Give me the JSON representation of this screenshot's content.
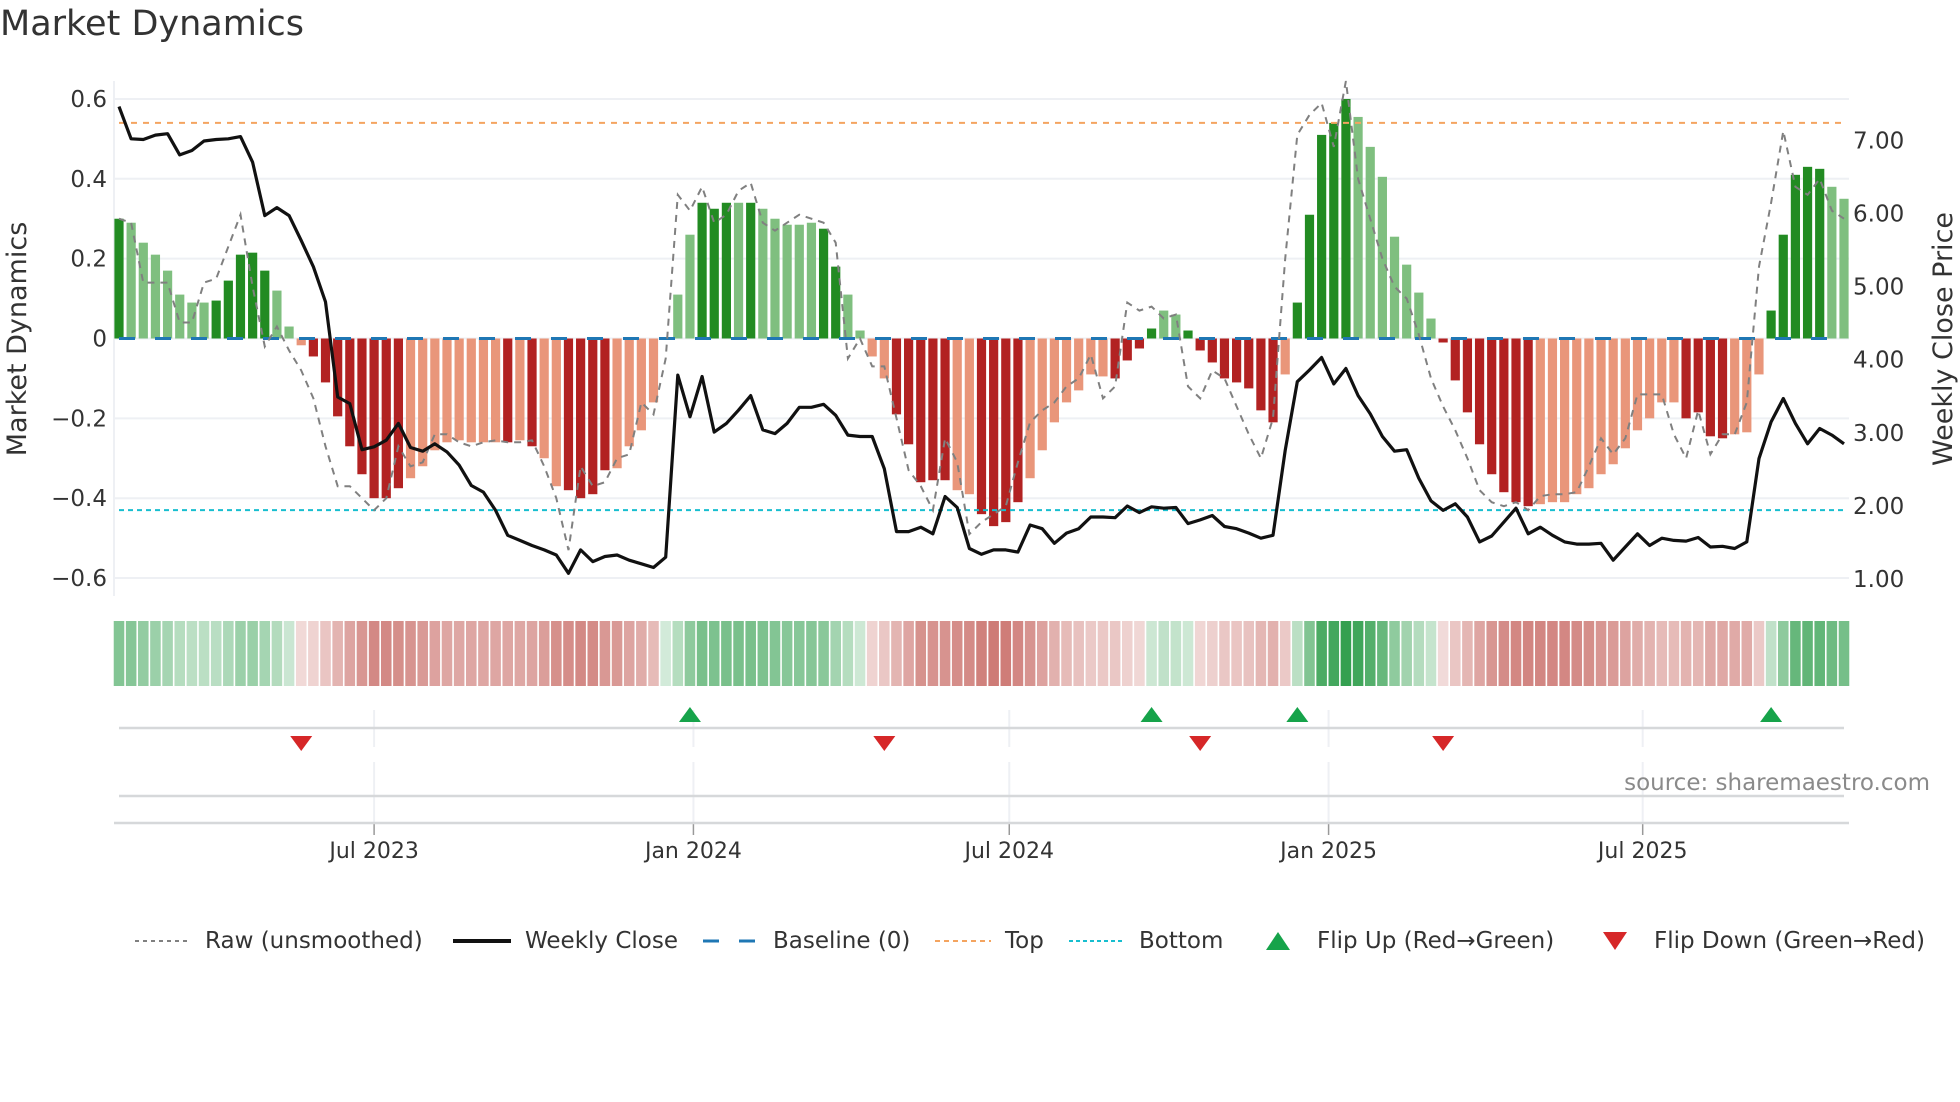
{
  "title": "Market Dynamics",
  "source_note": "source: sharemaestro.com",
  "colors": {
    "pos_strong": "#228b22",
    "pos_weak": "#7fbf7f",
    "neg_strong": "#b22222",
    "neg_weak": "#e9967a",
    "raw": "#808080",
    "close": "#111111",
    "baseline": "#1f77b4",
    "top": "#f4a460",
    "bottom": "#17becf",
    "flip_up": "#16a34a",
    "flip_down": "#d62728",
    "heat_pos": "#34a050",
    "heat_neg": "#c4605a"
  },
  "legend": {
    "raw": "Raw (unsmoothed)",
    "close": "Weekly Close",
    "baseline": "Baseline (0)",
    "top": "Top",
    "bottom": "Bottom",
    "flip_up": "Flip Up (Red→Green)",
    "flip_down": "Flip Down (Green→Red)"
  },
  "chart_data": {
    "type": "bar",
    "title": "Market Dynamics",
    "ylabel": "Market Dynamics",
    "y2label": "Weekly Close Price",
    "start_date": "2023-02-04",
    "frequency": "weekly",
    "ylim": [
      -0.645,
      0.645
    ],
    "y2lim": [
      0.77,
      7.81
    ],
    "yticks": [
      {
        "v": 0.6,
        "label": "0.6"
      },
      {
        "v": 0.4,
        "label": "0.4"
      },
      {
        "v": 0.2,
        "label": "0.2"
      },
      {
        "v": 0,
        "label": "0"
      },
      {
        "v": -0.2,
        "label": "−0.2"
      },
      {
        "v": -0.4,
        "label": "−0.4"
      },
      {
        "v": -0.6,
        "label": "−0.6"
      }
    ],
    "y2ticks": [
      {
        "v": 7,
        "label": "7.00"
      },
      {
        "v": 6,
        "label": "6.00"
      },
      {
        "v": 5,
        "label": "5.00"
      },
      {
        "v": 4,
        "label": "4.00"
      },
      {
        "v": 3,
        "label": "3.00"
      },
      {
        "v": 2,
        "label": "2.00"
      },
      {
        "v": 1,
        "label": "1.00"
      }
    ],
    "xticks": [
      {
        "date": "2023-07-01",
        "label": "Jul 2023"
      },
      {
        "date": "2024-01-01",
        "label": "Jan 2024"
      },
      {
        "date": "2024-07-01",
        "label": "Jul 2024"
      },
      {
        "date": "2025-01-01",
        "label": "Jan 2025"
      },
      {
        "date": "2025-07-01",
        "label": "Jul 2025"
      }
    ],
    "top_level": 0.54,
    "bottom_level": -0.43,
    "baseline": 0,
    "dynamics": [
      0.3,
      0.29,
      0.24,
      0.21,
      0.17,
      0.11,
      0.09,
      0.09,
      0.095,
      0.145,
      0.21,
      0.215,
      0.17,
      0.12,
      0.03,
      -0.017,
      -0.045,
      -0.11,
      -0.195,
      -0.27,
      -0.34,
      -0.4,
      -0.4,
      -0.375,
      -0.35,
      -0.32,
      -0.28,
      -0.26,
      -0.255,
      -0.26,
      -0.26,
      -0.26,
      -0.26,
      -0.255,
      -0.27,
      -0.3,
      -0.37,
      -0.38,
      -0.4,
      -0.39,
      -0.33,
      -0.325,
      -0.27,
      -0.23,
      -0.16,
      0.0,
      0.11,
      0.26,
      0.34,
      0.325,
      0.34,
      0.34,
      0.34,
      0.325,
      0.3,
      0.285,
      0.285,
      0.29,
      0.275,
      0.18,
      0.11,
      0.02,
      -0.045,
      -0.1,
      -0.19,
      -0.265,
      -0.36,
      -0.355,
      -0.355,
      -0.38,
      -0.39,
      -0.44,
      -0.47,
      -0.46,
      -0.41,
      -0.35,
      -0.28,
      -0.21,
      -0.16,
      -0.13,
      -0.09,
      -0.095,
      -0.1,
      -0.055,
      -0.025,
      0.025,
      0.07,
      0.06,
      0.02,
      -0.03,
      -0.06,
      -0.1,
      -0.11,
      -0.125,
      -0.18,
      -0.21,
      -0.09,
      0.09,
      0.31,
      0.51,
      0.54,
      0.6,
      0.555,
      0.48,
      0.405,
      0.255,
      0.185,
      0.115,
      0.05,
      -0.01,
      -0.105,
      -0.185,
      -0.265,
      -0.34,
      -0.385,
      -0.41,
      -0.42,
      -0.415,
      -0.41,
      -0.41,
      -0.39,
      -0.375,
      -0.34,
      -0.315,
      -0.275,
      -0.23,
      -0.2,
      -0.16,
      -0.16,
      -0.2,
      -0.185,
      -0.245,
      -0.25,
      -0.24,
      -0.235,
      -0.09,
      0.07,
      0.26,
      0.41,
      0.43,
      0.425,
      0.38,
      0.35
    ],
    "strength": "dllllllldddddlllddddddddlllllllldldlldddd",
    "strength_b": "llllllldddldlllllddlllldddddlldddd",
    "strength_c": "lllllllddddllddddddddldddddllllllld",
    "strength_d": "dddddddllllllllllllddddllldddddlll",
    "raw": [
      0.3,
      0.29,
      0.14,
      0.14,
      0.14,
      0.04,
      0.04,
      0.14,
      0.15,
      0.23,
      0.31,
      0.13,
      -0.02,
      0.03,
      -0.03,
      -0.08,
      -0.15,
      -0.27,
      -0.37,
      -0.37,
      -0.4,
      -0.43,
      -0.4,
      -0.27,
      -0.32,
      -0.31,
      -0.24,
      -0.24,
      -0.26,
      -0.27,
      -0.26,
      -0.255,
      -0.26,
      -0.26,
      -0.255,
      -0.32,
      -0.4,
      -0.53,
      -0.32,
      -0.37,
      -0.36,
      -0.3,
      -0.29,
      -0.16,
      -0.19,
      -0.05,
      0.36,
      0.32,
      0.38,
      0.29,
      0.31,
      0.37,
      0.39,
      0.29,
      0.27,
      0.29,
      0.31,
      0.3,
      0.29,
      0.24,
      -0.05,
      0.0,
      -0.07,
      -0.07,
      -0.2,
      -0.33,
      -0.37,
      -0.43,
      -0.25,
      -0.31,
      -0.49,
      -0.46,
      -0.44,
      -0.42,
      -0.31,
      -0.21,
      -0.18,
      -0.16,
      -0.12,
      -0.1,
      -0.04,
      -0.15,
      -0.12,
      0.09,
      0.07,
      0.08,
      0.05,
      0.06,
      -0.12,
      -0.15,
      -0.08,
      -0.1,
      -0.17,
      -0.24,
      -0.3,
      -0.2,
      0.2,
      0.51,
      0.56,
      0.59,
      0.48,
      0.65,
      0.4,
      0.3,
      0.2,
      0.13,
      0.1,
      0.01,
      -0.1,
      -0.17,
      -0.23,
      -0.3,
      -0.38,
      -0.41,
      -0.42,
      -0.41,
      -0.43,
      -0.395,
      -0.39,
      -0.39,
      -0.385,
      -0.32,
      -0.25,
      -0.29,
      -0.25,
      -0.14,
      -0.14,
      -0.14,
      -0.24,
      -0.3,
      -0.18,
      -0.29,
      -0.24,
      -0.24,
      -0.16,
      0.18,
      0.34,
      0.52,
      0.38,
      0.36,
      0.4,
      0.32,
      0.3
    ],
    "weekly_close": [
      7.46,
      7.02,
      7.01,
      7.07,
      7.09,
      6.8,
      6.86,
      6.99,
      7.01,
      7.02,
      7.05,
      6.7,
      5.97,
      6.08,
      5.97,
      5.63,
      5.27,
      4.79,
      3.49,
      3.4,
      2.77,
      2.81,
      2.9,
      3.13,
      2.8,
      2.75,
      2.85,
      2.74,
      2.56,
      2.28,
      2.19,
      1.94,
      1.6,
      1.53,
      1.46,
      1.4,
      1.33,
      1.08,
      1.4,
      1.24,
      1.31,
      1.33,
      1.26,
      1.21,
      1.16,
      1.3,
      3.79,
      3.22,
      3.77,
      3.01,
      3.13,
      3.31,
      3.51,
      3.04,
      2.99,
      3.13,
      3.35,
      3.35,
      3.39,
      3.24,
      2.97,
      2.95,
      2.95,
      2.51,
      1.65,
      1.65,
      1.71,
      1.62,
      2.13,
      1.98,
      1.42,
      1.34,
      1.4,
      1.4,
      1.37,
      1.74,
      1.69,
      1.49,
      1.63,
      1.69,
      1.85,
      1.85,
      1.84,
      2.0,
      1.91,
      1.99,
      1.97,
      1.98,
      1.76,
      1.81,
      1.87,
      1.72,
      1.69,
      1.63,
      1.56,
      1.6,
      2.76,
      3.7,
      3.86,
      4.03,
      3.67,
      3.88,
      3.51,
      3.26,
      2.95,
      2.75,
      2.77,
      2.38,
      2.07,
      1.94,
      2.03,
      1.85,
      1.51,
      1.59,
      1.78,
      1.97,
      1.62,
      1.71,
      1.6,
      1.51,
      1.48,
      1.48,
      1.49,
      1.26,
      1.44,
      1.62,
      1.46,
      1.56,
      1.53,
      1.52,
      1.57,
      1.44,
      1.45,
      1.42,
      1.51,
      2.65,
      3.15,
      3.47,
      3.13,
      2.85,
      3.06,
      2.97,
      2.85
    ],
    "flips_up": [
      "2023-12-30",
      "2024-09-21",
      "2024-12-14",
      "2025-09-13"
    ],
    "flips_down": [
      "2023-05-20",
      "2024-04-20",
      "2024-10-19",
      "2025-03-08"
    ],
    "legend_position": "bottom"
  }
}
